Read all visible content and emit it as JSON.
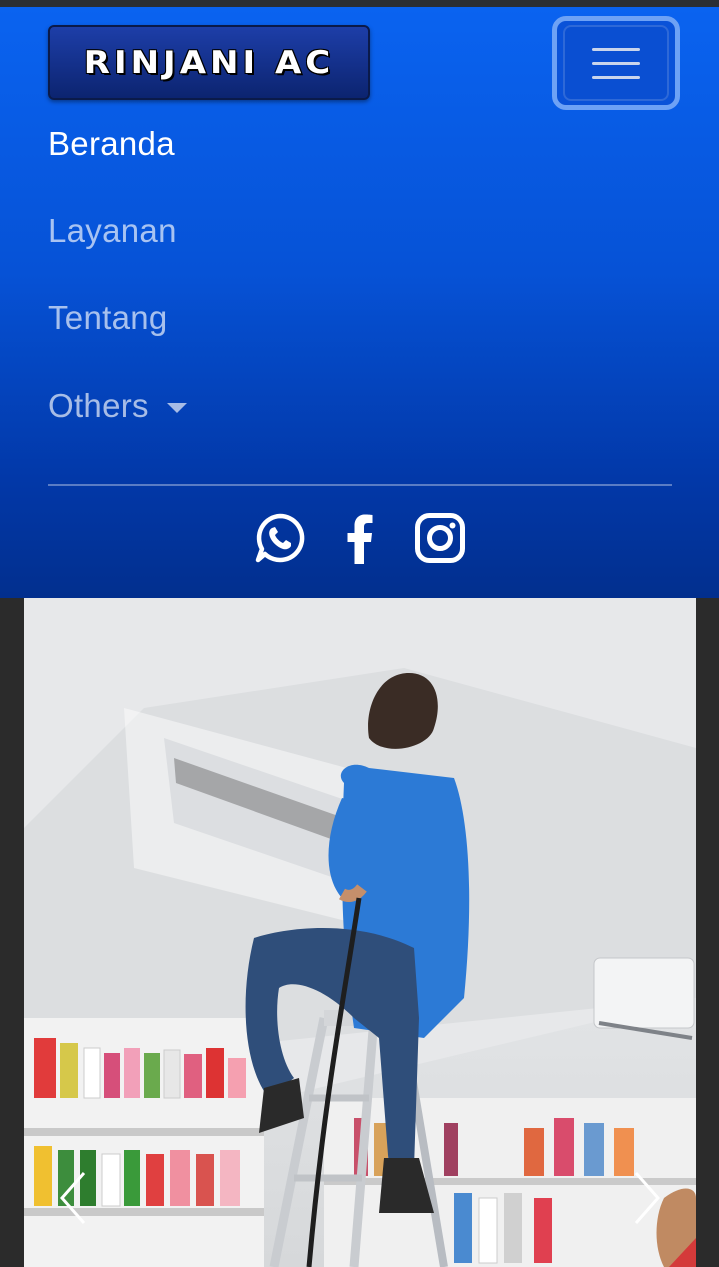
{
  "brand": {
    "name": "RINJANI AC"
  },
  "nav": {
    "items": [
      {
        "label": "Beranda",
        "active": true
      },
      {
        "label": "Layanan"
      },
      {
        "label": "Tentang"
      },
      {
        "label": "Others",
        "dropdown": true
      }
    ]
  },
  "social": [
    "whatsapp-icon",
    "facebook-icon",
    "instagram-icon"
  ],
  "carousel": {
    "image_subject": "technician-servicing-air-conditioner",
    "controls": [
      "prev-icon",
      "next-icon"
    ]
  },
  "colors": {
    "navbar_top": "#0a63f0",
    "navbar_bottom": "#022f8e",
    "toggler_border": "#6ea2f5"
  }
}
